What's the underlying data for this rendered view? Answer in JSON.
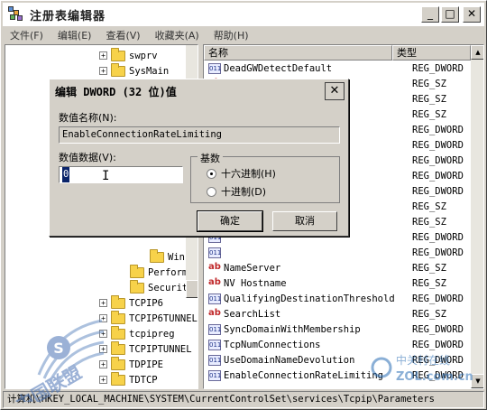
{
  "window": {
    "title": "注册表编辑器",
    "min": "_",
    "max": "□",
    "close": "✕"
  },
  "menu": [
    {
      "label": "文件(F)"
    },
    {
      "label": "编辑(E)"
    },
    {
      "label": "查看(V)"
    },
    {
      "label": "收藏夹(A)"
    },
    {
      "label": "帮助(H)"
    }
  ],
  "tree": {
    "items": [
      {
        "label": "swprv",
        "expander": "+"
      },
      {
        "label": "SysMain",
        "expander": "+"
      },
      {
        "label": "Winsock",
        "expander": ""
      },
      {
        "label": "Performance",
        "expander": ""
      },
      {
        "label": "Security",
        "expander": ""
      },
      {
        "label": "TCPIP6",
        "expander": "+"
      },
      {
        "label": "TCPIP6TUNNEL",
        "expander": "+"
      },
      {
        "label": "tcpipreg",
        "expander": "+"
      },
      {
        "label": "TCPIPTUNNEL",
        "expander": "+"
      },
      {
        "label": "TDPIPE",
        "expander": "+"
      },
      {
        "label": "TDTCP",
        "expander": "+"
      }
    ]
  },
  "list": {
    "headers": {
      "name": "名称",
      "type": "类型"
    },
    "rows": [
      {
        "name": "DeadGWDetectDefault",
        "type": "REG_DWORD",
        "icon": "dword"
      },
      {
        "name": "",
        "type": "REG_SZ",
        "icon": "sz"
      },
      {
        "name": "",
        "type": "REG_SZ",
        "icon": "sz"
      },
      {
        "name": "",
        "type": "REG_SZ",
        "icon": "sz"
      },
      {
        "name": "fault",
        "type": "REG_DWORD",
        "icon": "dword"
      },
      {
        "name": "",
        "type": "REG_DWORD",
        "icon": "dword"
      },
      {
        "name": "",
        "type": "REG_DWORD",
        "icon": "dword"
      },
      {
        "name": "",
        "type": "REG_DWORD",
        "icon": "dword"
      },
      {
        "name": "",
        "type": "REG_DWORD",
        "icon": "dword"
      },
      {
        "name": "",
        "type": "REG_SZ",
        "icon": "sz"
      },
      {
        "name": "",
        "type": "REG_SZ",
        "icon": "sz"
      },
      {
        "name": "",
        "type": "REG_DWORD",
        "icon": "dword"
      },
      {
        "name": "",
        "type": "REG_DWORD",
        "icon": "dword"
      },
      {
        "name": "NameServer",
        "type": "REG_SZ",
        "icon": "sz"
      },
      {
        "name": "NV Hostname",
        "type": "REG_SZ",
        "icon": "sz"
      },
      {
        "name": "QualifyingDestinationThreshold",
        "type": "REG_DWORD",
        "icon": "dword"
      },
      {
        "name": "SearchList",
        "type": "REG_SZ",
        "icon": "sz"
      },
      {
        "name": "SyncDomainWithMembership",
        "type": "REG_DWORD",
        "icon": "dword"
      },
      {
        "name": "TcpNumConnections",
        "type": "REG_DWORD",
        "icon": "dword"
      },
      {
        "name": "UseDomainNameDevolution",
        "type": "REG_DWORD",
        "icon": "dword"
      },
      {
        "name": "EnableConnectionRateLimiting",
        "type": "REG_DWORD",
        "icon": "dword"
      }
    ]
  },
  "status": {
    "path": "计算机\\HKEY_LOCAL_MACHINE\\SYSTEM\\CurrentControlSet\\services\\Tcpip\\Parameters"
  },
  "dialog": {
    "title": "编辑 DWORD (32 位)值",
    "close": "✕",
    "name_label": "数值名称(N):",
    "name_value": "EnableConnectionRateLimiting",
    "data_label": "数值数据(V):",
    "data_value": "0",
    "base_label": "基数",
    "hex_label": "十六进制(H)",
    "dec_label": "十进制(D)",
    "ok": "确定",
    "cancel": "取消"
  },
  "watermarks": {
    "left": "中国联盟",
    "right_top": "中关村在线",
    "right_bottom": "ZOL.com.cn"
  }
}
